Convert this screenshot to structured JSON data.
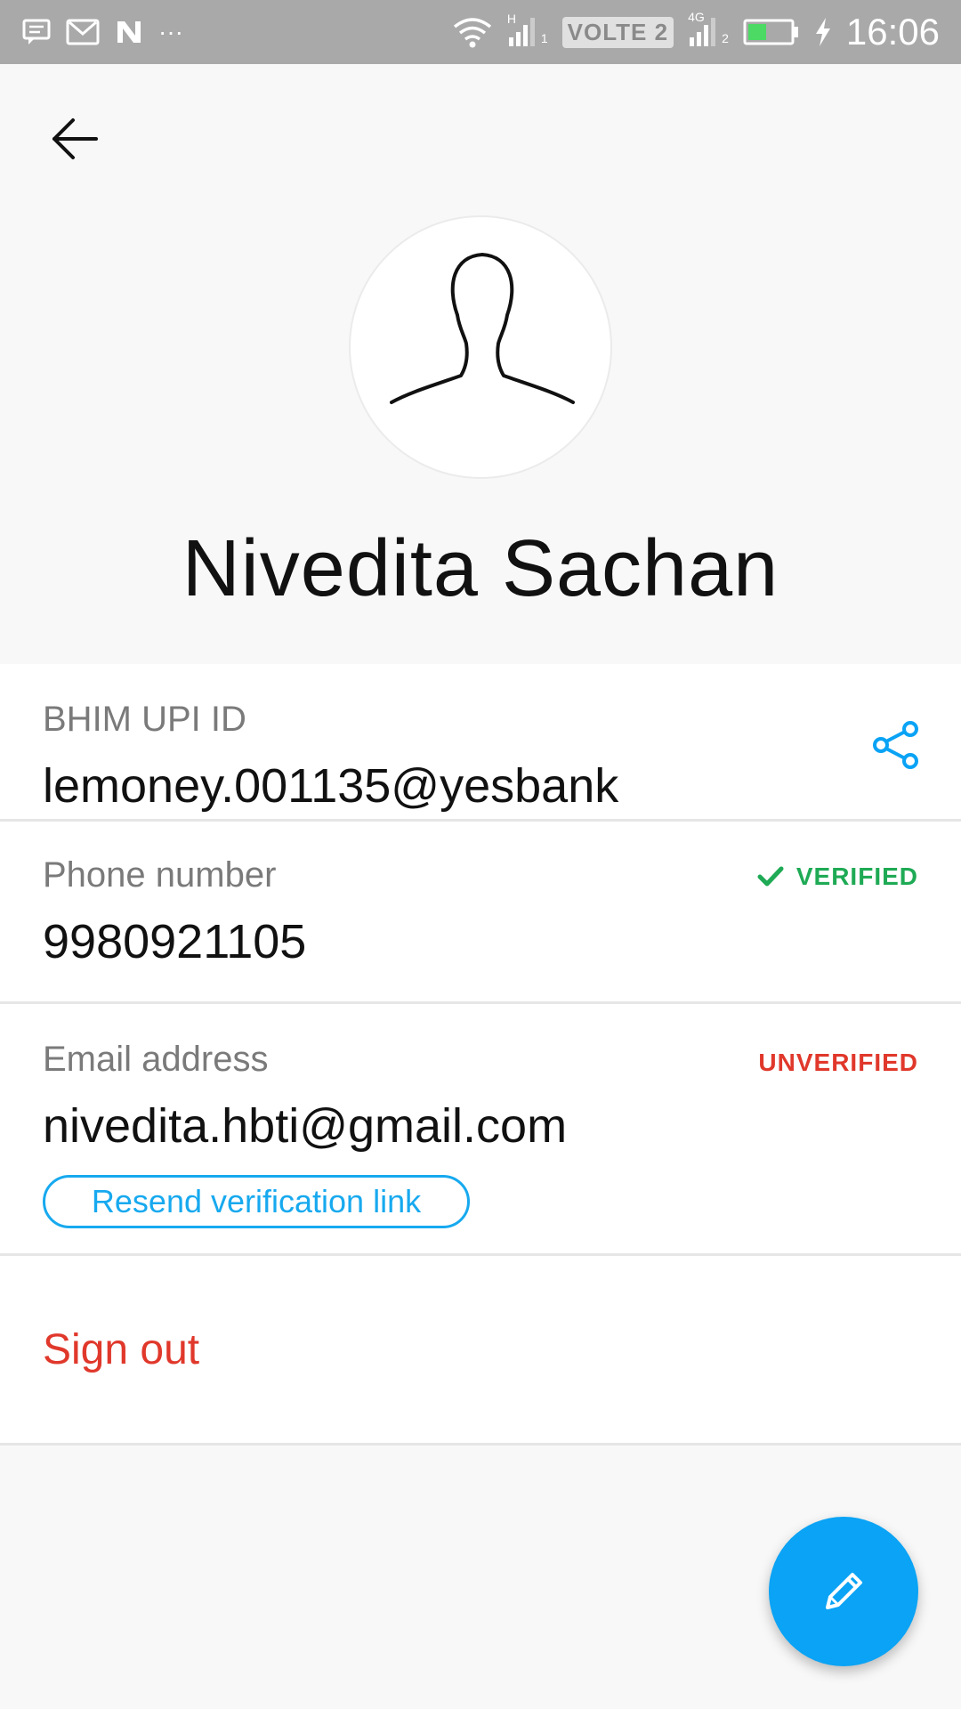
{
  "status_bar": {
    "left_icons": [
      "message-icon",
      "gmail-icon",
      "n-app-icon"
    ],
    "more": "···",
    "sim1_type": "H",
    "sim1_index": "1",
    "volte": "VOLTE 2",
    "sim2_type": "4G",
    "sim2_index": "2",
    "time": "16:06"
  },
  "profile": {
    "name": "Nivedita Sachan"
  },
  "upi": {
    "label": "BHIM UPI ID",
    "value": "lemoney.001135@yesbank"
  },
  "phone": {
    "label": "Phone number",
    "value": "9980921105",
    "status": "VERIFIED"
  },
  "email": {
    "label": "Email address",
    "value": "nivedita.hbti@gmail.com",
    "status": "UNVERIFIED",
    "resend_label": "Resend verification link"
  },
  "actions": {
    "sign_out": "Sign out"
  },
  "colors": {
    "accent": "#0aa3f5",
    "verified": "#1faa55",
    "unverified": "#e0382b"
  }
}
